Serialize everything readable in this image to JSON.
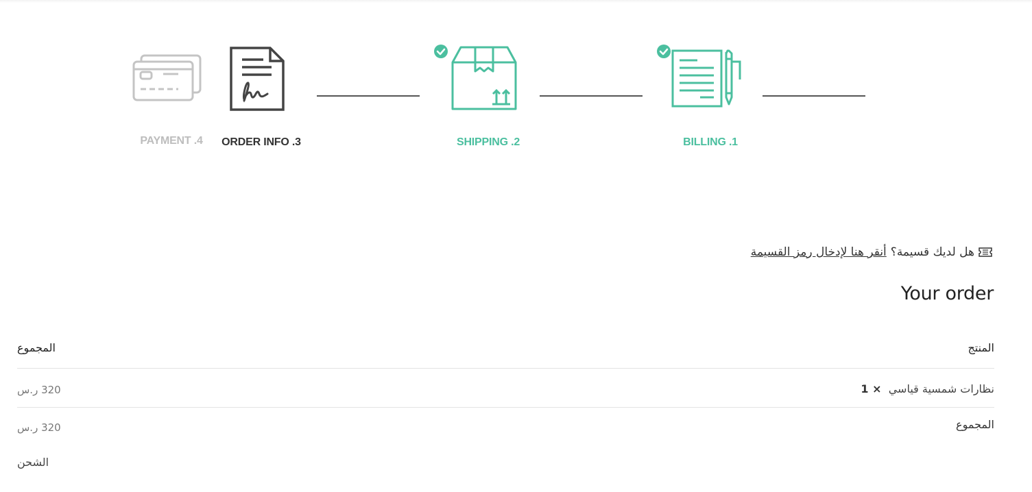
{
  "steps": [
    {
      "label": "BILLING .1",
      "status": "done",
      "icon": "billing-document-pen-icon"
    },
    {
      "label": "SHIPPING .2",
      "status": "done",
      "icon": "package-box-icon"
    },
    {
      "label": "ORDER INFO .3",
      "status": "current",
      "icon": "signed-document-icon"
    },
    {
      "label": "PAYMENT .4",
      "status": "pending",
      "icon": "credit-cards-icon"
    }
  ],
  "colors": {
    "done": "#4bbf9f",
    "current": "#333333",
    "pending": "#bdbdbd",
    "connector": "#555555"
  },
  "coupon": {
    "icon": "ticket-icon",
    "question": "هل لديك قسيمة؟",
    "link": "أنقر هنا لإدخال رمز القسيمة"
  },
  "order": {
    "heading": "Your order",
    "columns": {
      "product": "المنتج",
      "total": "المجموع"
    },
    "items": [
      {
        "name": "نظارات شمسية قياسي",
        "qty": "× 1",
        "total": "320 ر.س"
      }
    ],
    "subtotal_label": "المجموع",
    "subtotal_value": "320 ر.س",
    "shipping_label": "الشحن"
  }
}
